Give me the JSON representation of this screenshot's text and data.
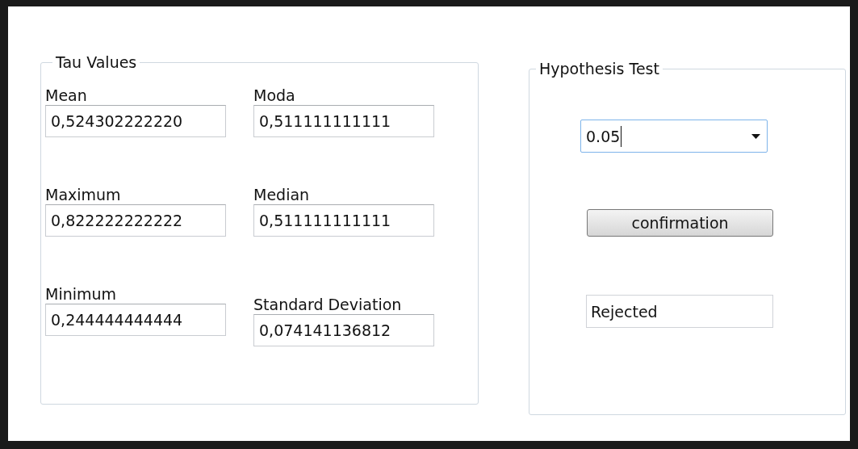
{
  "tau_values": {
    "title": "Tau Values",
    "fields": [
      {
        "label": "Mean",
        "value": "0,524302222220"
      },
      {
        "label": "Moda",
        "value": "0,511111111111"
      },
      {
        "label": "Maximum",
        "value": "0,822222222222"
      },
      {
        "label": "Median",
        "value": "0,511111111111"
      },
      {
        "label": "Minimum",
        "value": "0,244444444444"
      },
      {
        "label": "Standard Deviation",
        "value": "0,074141136812"
      }
    ]
  },
  "hypothesis_test": {
    "title": "Hypothesis Test",
    "significance": {
      "value": "0.05",
      "focused": true
    },
    "button": "confirmation",
    "result": "Rejected"
  }
}
